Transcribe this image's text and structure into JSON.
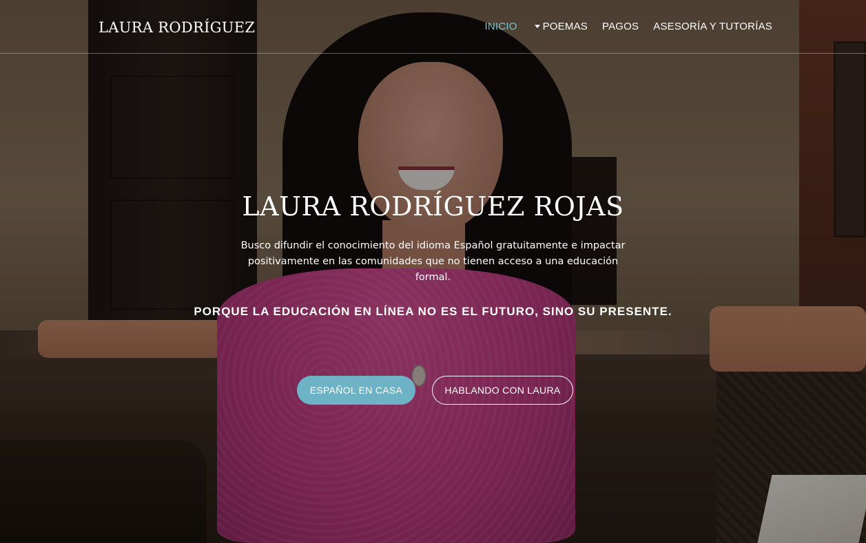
{
  "header": {
    "brand": "LAURA RODRÍGUEZ",
    "nav": [
      {
        "label": "INICIO",
        "active": true
      },
      {
        "label": "POEMAS",
        "has_dropdown": true
      },
      {
        "label": "PAGOS"
      },
      {
        "label": "ASESORÍA Y TUTORÍAS"
      }
    ]
  },
  "hero": {
    "title": "LAURA RODRÍGUEZ ROJAS",
    "description": "Busco difundir el conocimiento del idioma Español gratuitamente e impactar positivamente en las comunidades que no tienen acceso a una educación formal.",
    "tagline": "PORQUE LA EDUCACIÓN EN LÍNEA NO ES EL FUTURO, SINO SU PRESENTE.",
    "buttons": {
      "primary": "ESPAÑOL EN CASA",
      "secondary": "HABLANDO CON LAURA"
    }
  },
  "colors": {
    "accent": "#6db3c5",
    "active_nav": "#7cc3d3"
  }
}
